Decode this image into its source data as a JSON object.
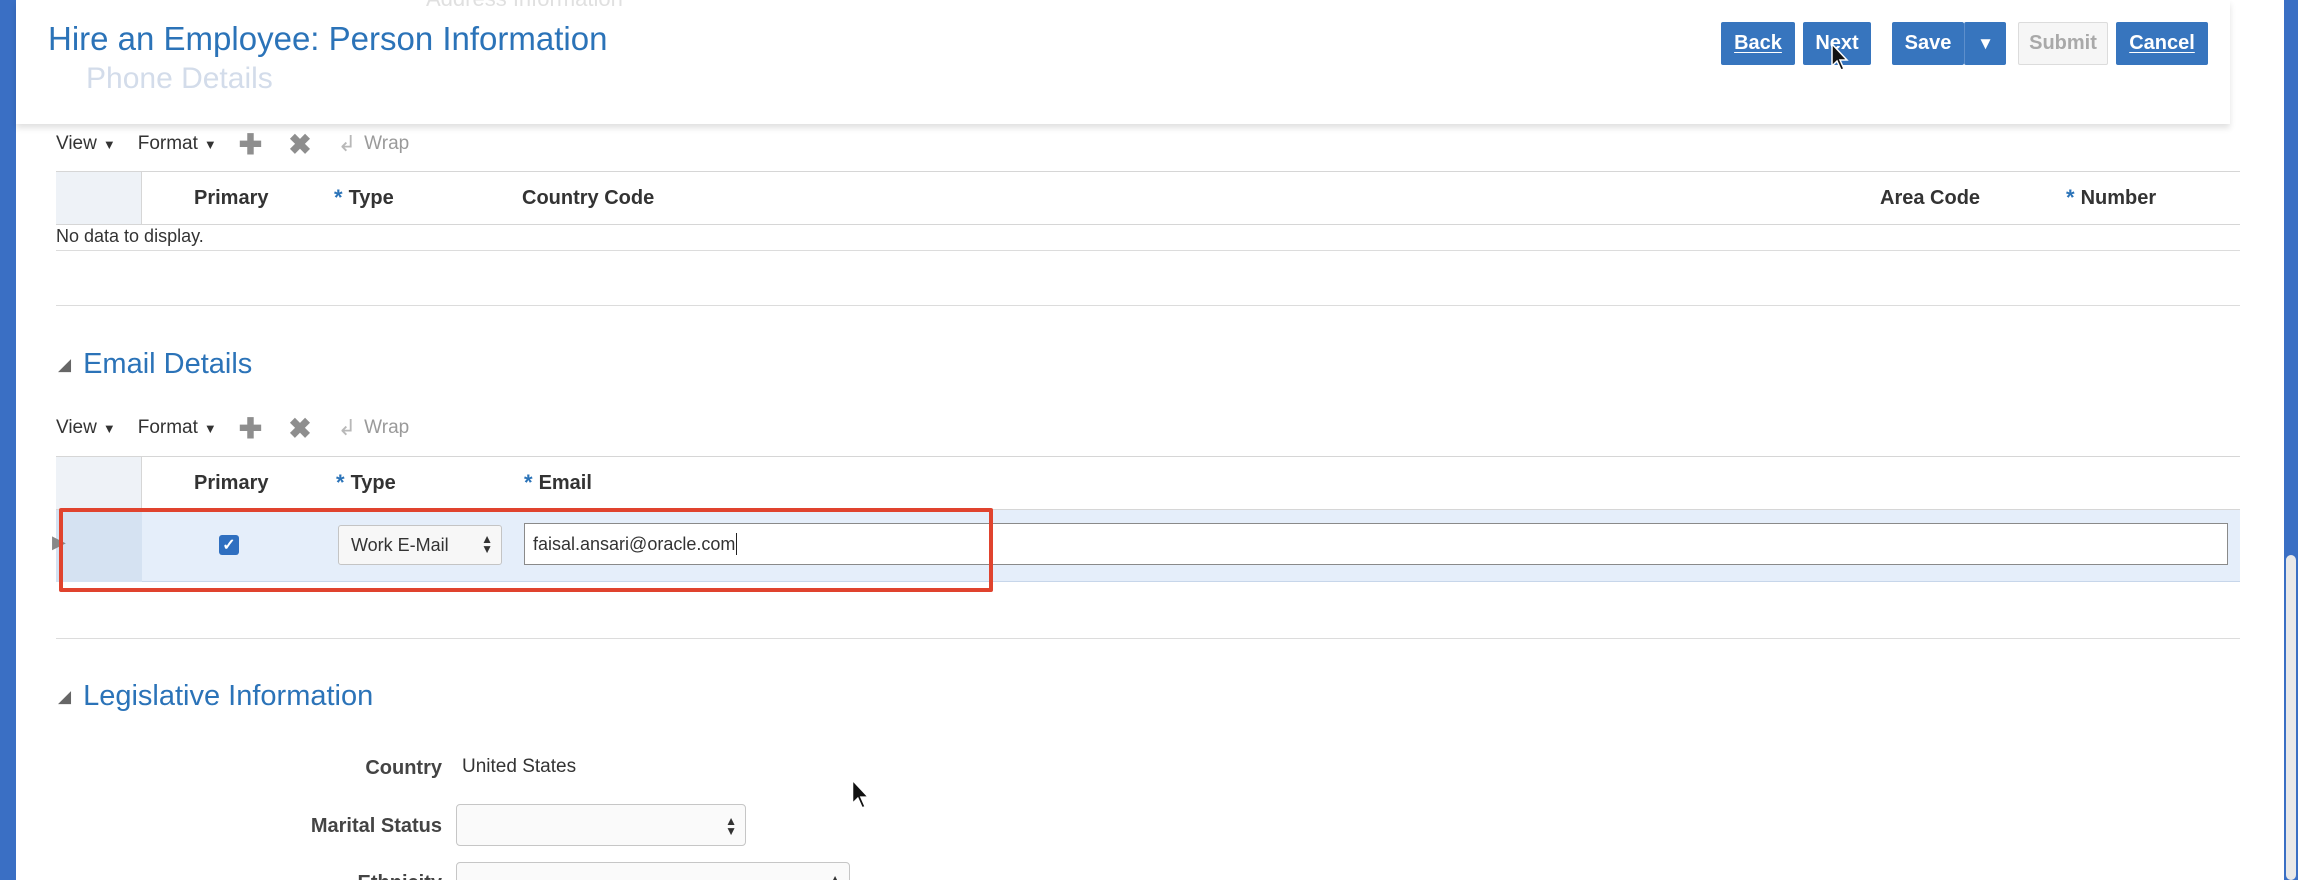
{
  "header": {
    "title": "Hire an Employee: Person Information",
    "ghost_behind": "Phone Details",
    "ghost_top": "Address Information",
    "buttons": {
      "back": "Back",
      "next": "Next",
      "save": "Save",
      "save_menu": "▼",
      "submit": "Submit",
      "cancel": "Cancel"
    }
  },
  "phone_details": {
    "toolbar": {
      "view": "View",
      "format": "Format",
      "add_icon": "plus-icon",
      "delete_icon": "x-icon",
      "wrap": "Wrap"
    },
    "columns": {
      "primary": "Primary",
      "type": "Type",
      "country_code": "Country Code",
      "area_code": "Area Code",
      "number": "Number"
    },
    "required_mark": "*",
    "empty_message": "No data to display."
  },
  "email_details": {
    "title": "Email Details",
    "toolbar": {
      "view": "View",
      "format": "Format",
      "wrap": "Wrap"
    },
    "columns": {
      "primary": "Primary",
      "type": "Type",
      "email": "Email"
    },
    "required_mark": "*",
    "row": {
      "primary_checked": true,
      "type_value": "Work E-Mail",
      "email_value": "faisal.ansari@oracle.com"
    }
  },
  "legislative": {
    "title": "Legislative Information",
    "country_label": "Country",
    "country_value": "United States",
    "marital_status_label": "Marital Status",
    "marital_status_value": "",
    "ethnicity_label": "Ethnicity",
    "ethnicity_value": ""
  },
  "colors": {
    "accent": "#2b73b8",
    "button": "#3775be",
    "highlight": "#e0432e",
    "row_selected": "#e5eefa"
  }
}
